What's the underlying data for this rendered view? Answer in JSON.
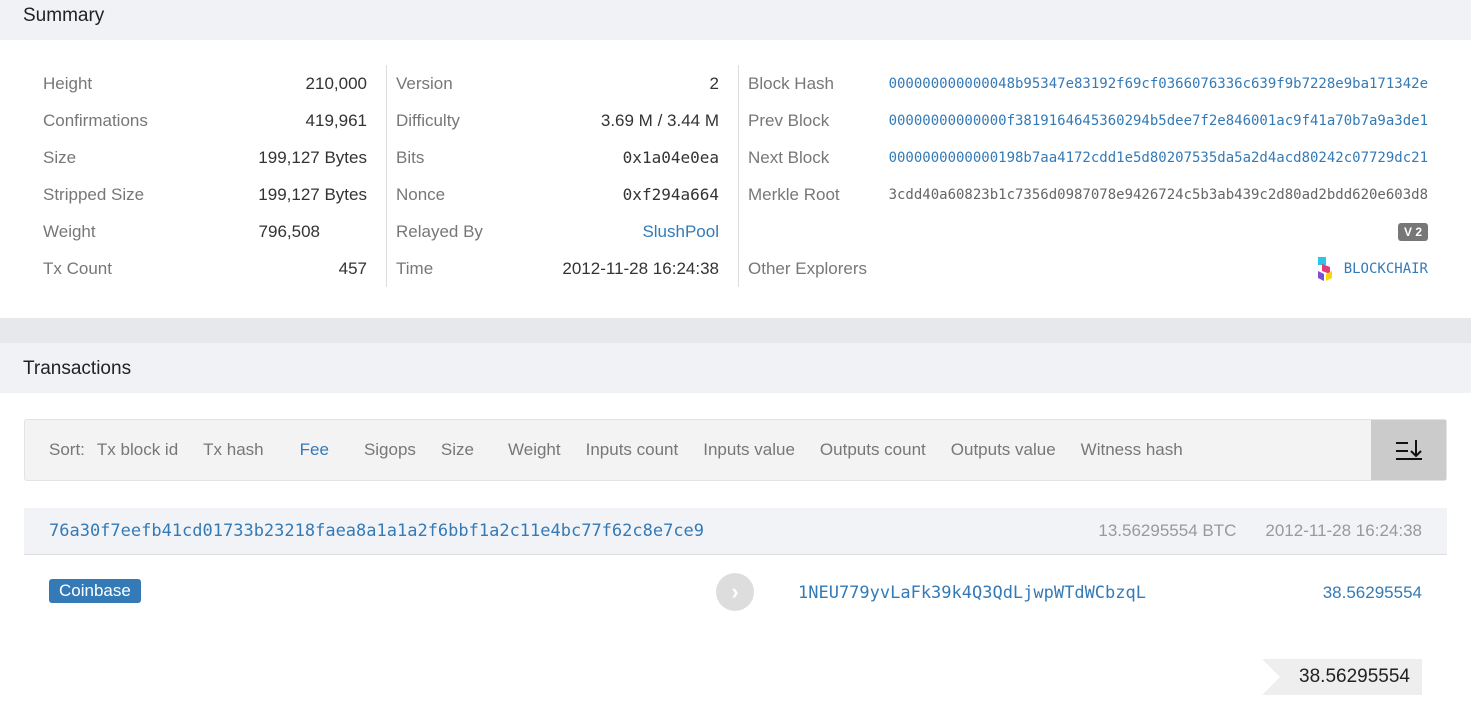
{
  "summary": {
    "title": "Summary",
    "col1": [
      {
        "label": "Height",
        "value": "210,000"
      },
      {
        "label": "Confirmations",
        "value": "419,961"
      },
      {
        "label": "Size",
        "value": "199,127 Bytes"
      },
      {
        "label": "Stripped Size",
        "value": "199,127 Bytes"
      },
      {
        "label": "Weight",
        "value": "796,508"
      },
      {
        "label": "Tx Count",
        "value": "457"
      }
    ],
    "col2": [
      {
        "label": "Version",
        "value": "2"
      },
      {
        "label": "Difficulty",
        "value": "3.69 M / 3.44 M"
      },
      {
        "label": "Bits",
        "value": "0x1a04e0ea"
      },
      {
        "label": "Nonce",
        "value": "0xf294a664"
      },
      {
        "label": "Relayed By",
        "value": "SlushPool"
      },
      {
        "label": "Time",
        "value": "2012-11-28 16:24:38"
      }
    ],
    "col3": [
      {
        "label": "Block Hash",
        "value": "000000000000048b95347e83192f69cf0366076336c639f9b7228e9ba171342e"
      },
      {
        "label": "Prev Block",
        "value": "00000000000000f3819164645360294b5dee7f2e846001ac9f41a70b7a9a3de1"
      },
      {
        "label": "Next Block",
        "value": "0000000000000198b7aa4172cdd1e5d80207535da5a2d4acd80242c07729dc21"
      },
      {
        "label": "Merkle Root",
        "value": "3cdd40a60823b1c7356d0987078e9426724c5b3ab439c2d80ad2bdd620e603d8"
      }
    ],
    "version_badge": "V 2",
    "other_explorers_label": "Other Explorers",
    "explorer": "BLOCKCHAIR"
  },
  "transactions": {
    "title": "Transactions",
    "sort_label": "Sort:",
    "sort_options": [
      "Tx block id",
      "Tx hash",
      "Fee",
      "Sigops",
      "Size",
      "Weight",
      "Inputs count",
      "Inputs value",
      "Outputs count",
      "Outputs value",
      "Witness hash"
    ],
    "tx": {
      "hash": "76a30f7eefb41cd01733b23218faea8a1a1a2f6bbf1a2c11e4bc77f62c8e7ce9",
      "amount": "13.56295554 BTC",
      "time": "2012-11-28 16:24:38",
      "input": "Coinbase",
      "output_address": "1NEU779yvLaFk39k4Q3QdLjwpWTdWCbzqL",
      "output_value": "38.56295554",
      "total": "38.56295554"
    }
  }
}
